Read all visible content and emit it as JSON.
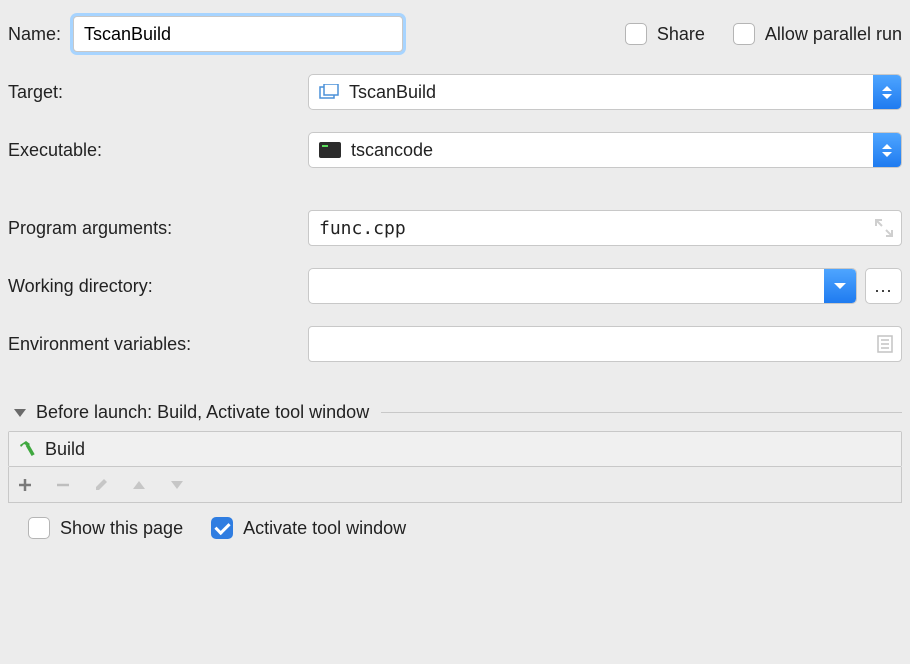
{
  "form": {
    "name_label": "Name:",
    "name_value": "TscanBuild",
    "share_label": "Share",
    "allow_parallel_label": "Allow parallel run",
    "target_label": "Target:",
    "target_value": "TscanBuild",
    "executable_label": "Executable:",
    "executable_value": "tscancode",
    "program_args_label": "Program arguments:",
    "program_args_value": "func.cpp",
    "working_dir_label": "Working directory:",
    "working_dir_value": "",
    "env_vars_label": "Environment variables:",
    "env_vars_value": "",
    "browse_label": "..."
  },
  "before_launch": {
    "header": "Before launch: Build, Activate tool window",
    "tasks": [
      {
        "label": "Build"
      }
    ],
    "show_page_label": "Show this page",
    "activate_tool_label": "Activate tool window",
    "show_page_checked": false,
    "activate_tool_checked": true
  }
}
